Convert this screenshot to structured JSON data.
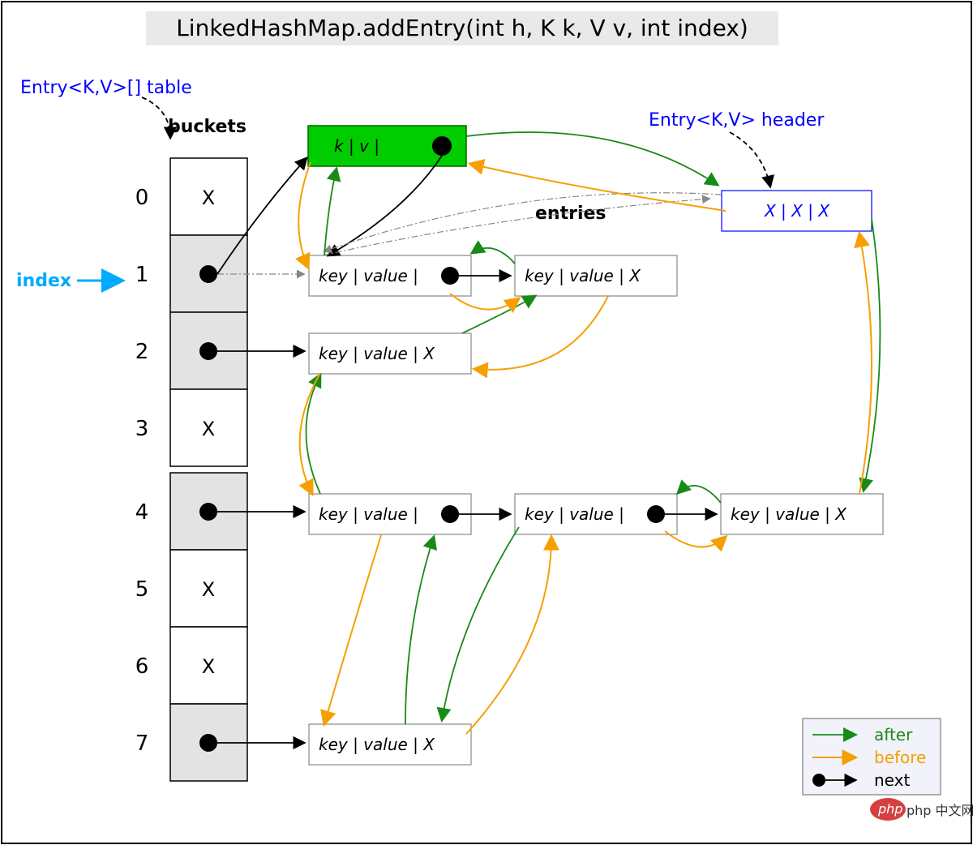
{
  "title": "LinkedHashMap.addEntry(int h, K k, V v, int index)",
  "labels": {
    "table": "Entry<K,V>[] table",
    "header": "Entry<K,V> header",
    "buckets": "buckets",
    "entries": "entries",
    "index": "index"
  },
  "bucket_indices": [
    "0",
    "1",
    "2",
    "3",
    "4",
    "5",
    "6",
    "7"
  ],
  "bucket_cells": [
    "X",
    "●",
    "●",
    "X",
    "●",
    "X",
    "X",
    "●"
  ],
  "new_entry": "k  |  v  | ",
  "header_entry": "X   |   X   |  X",
  "entries_row1": [
    "key | value | ",
    "key | value |  X"
  ],
  "entries_row2": "key | value |  X",
  "entries_row4": [
    "key | value | ",
    "key | value | ",
    "key | value |  X"
  ],
  "entries_row7": "key | value |  X",
  "legend": {
    "after": "after",
    "before": "before",
    "next": "next"
  },
  "watermark": "php 中文网",
  "chart_data": {
    "type": "diagram",
    "structure": "LinkedHashMap",
    "bucket_count": 8,
    "index_selected": 1,
    "buckets": [
      {
        "idx": 0,
        "entries": 0
      },
      {
        "idx": 1,
        "entries": 2
      },
      {
        "idx": 2,
        "entries": 1
      },
      {
        "idx": 3,
        "entries": 0
      },
      {
        "idx": 4,
        "entries": 3
      },
      {
        "idx": 5,
        "entries": 0
      },
      {
        "idx": 6,
        "entries": 0
      },
      {
        "idx": 7,
        "entries": 1
      }
    ],
    "new_entry_bucket": 1,
    "pointer_colors": {
      "after": "green",
      "before": "orange",
      "next": "black"
    }
  }
}
